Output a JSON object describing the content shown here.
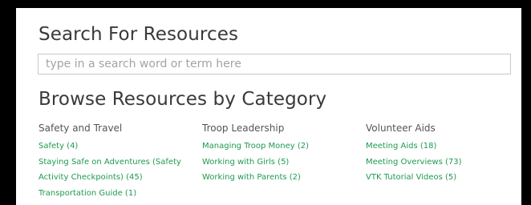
{
  "search": {
    "title": "Search For Resources",
    "placeholder": "type in a search word or term here"
  },
  "browse": {
    "title": "Browse Resources by Category"
  },
  "colors": {
    "link": "#1f9a4f",
    "heading": "#3a3a3a",
    "frame": "#000000"
  },
  "categories": [
    {
      "heading": "Safety and Travel",
      "links": [
        "Safety (4)",
        "Staying Safe on Adventures (Safety",
        "Activity Checkpoints) (45)",
        "Transportation Guide (1)"
      ]
    },
    {
      "heading": "Troop Leadership",
      "links": [
        "Managing Troop Money (2)",
        "Working with Girls (5)",
        "Working with Parents (2)"
      ]
    },
    {
      "heading": "Volunteer Aids",
      "links": [
        "Meeting Aids (18)",
        "Meeting Overviews (73)",
        "VTK Tutorial Videos (5)"
      ]
    }
  ]
}
